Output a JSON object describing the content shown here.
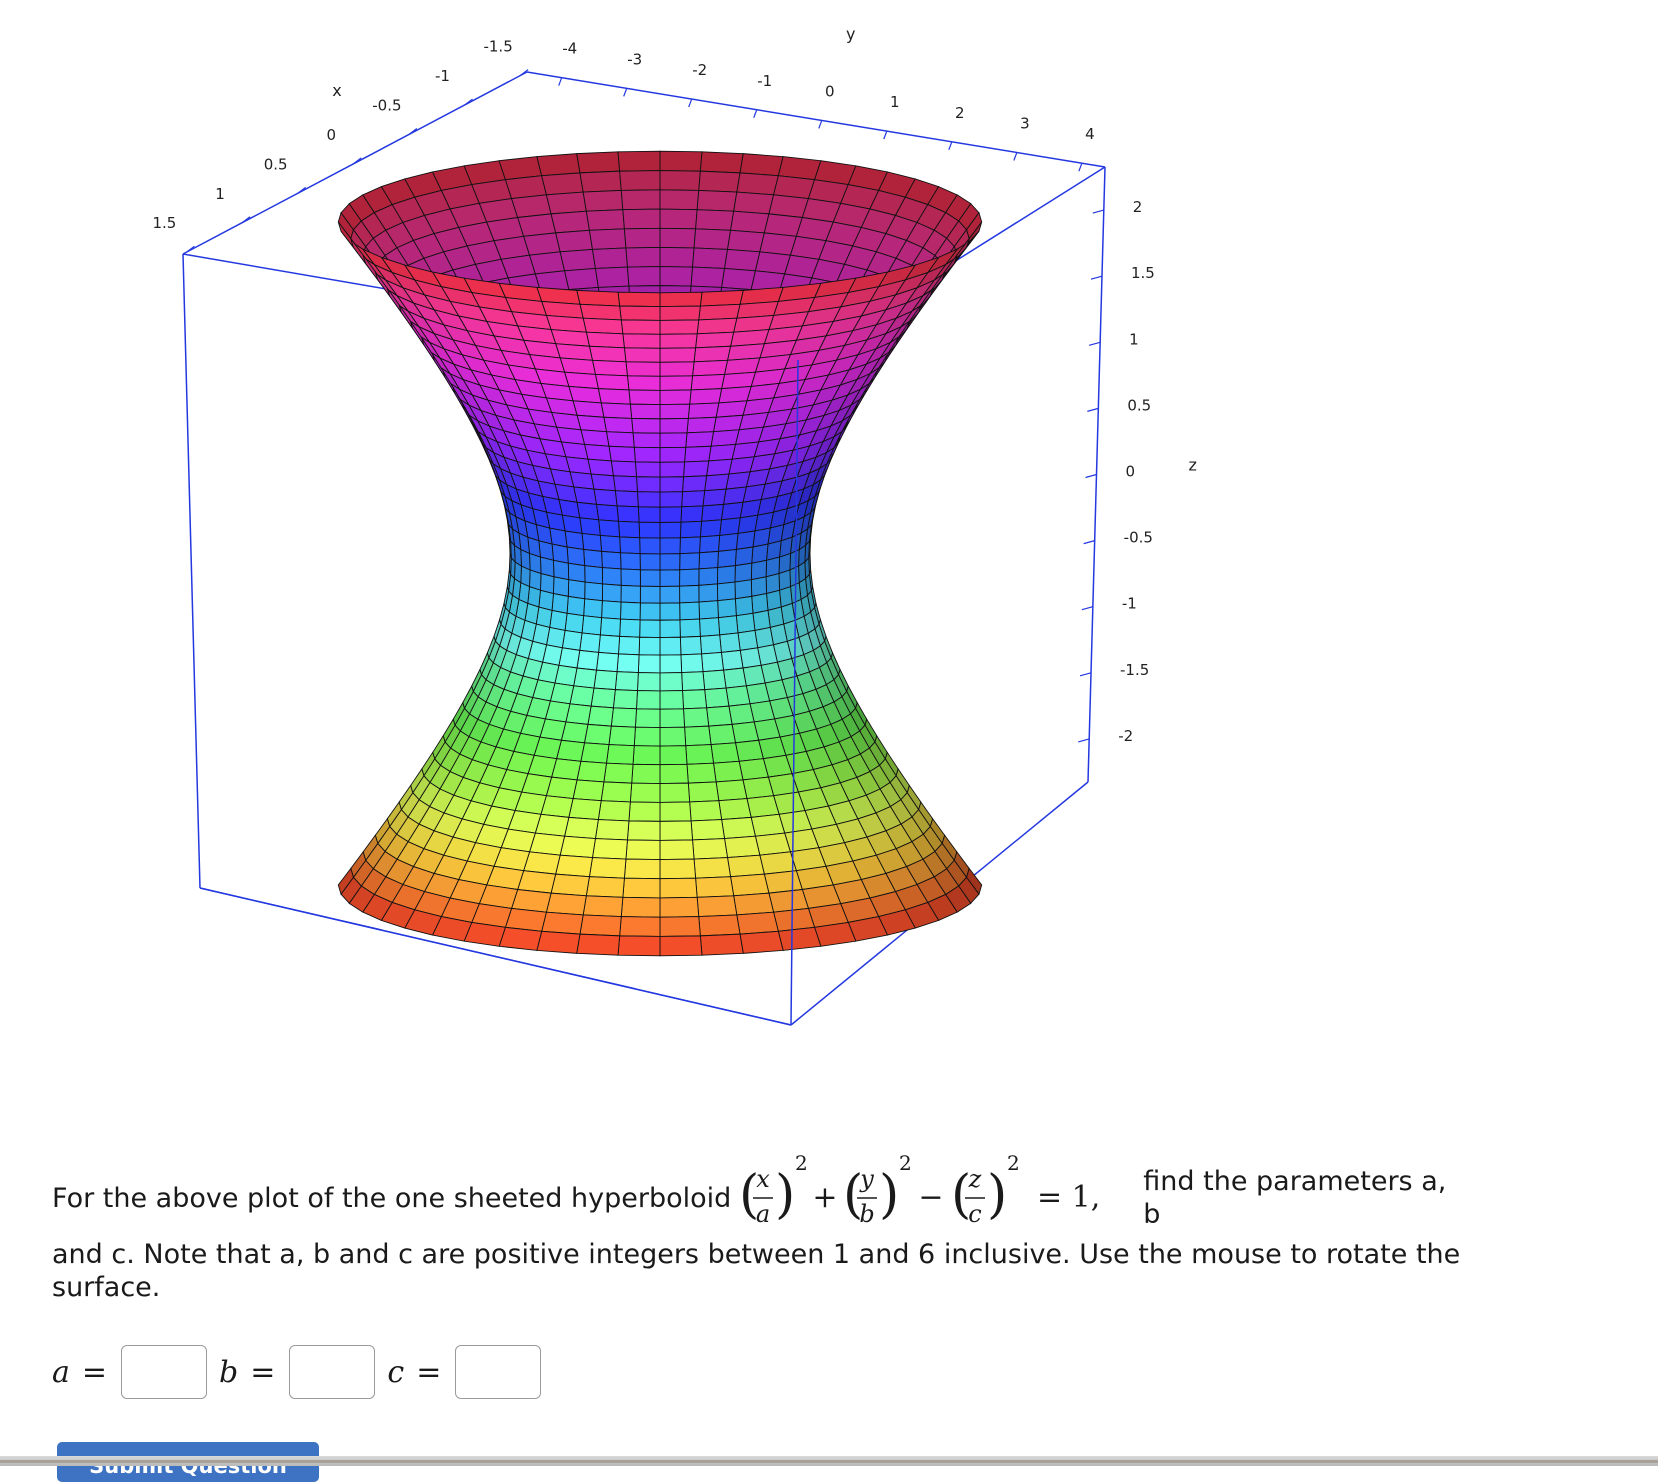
{
  "plot": {
    "surface": "one sheeted hyperboloid",
    "axis_color": "#2438e0",
    "axes": {
      "x": {
        "name": "x",
        "ticks": [
          "-1.5",
          "-1",
          "-0.5",
          "0",
          "0.5",
          "1",
          "1.5"
        ]
      },
      "y": {
        "name": "y",
        "ticks": [
          "-4",
          "-3",
          "-2",
          "-1",
          "0",
          "1",
          "2",
          "3",
          "4"
        ]
      },
      "z": {
        "name": "z",
        "ticks": [
          "2",
          "1.5",
          "1",
          "0.5",
          "0",
          "-0.5",
          "-1",
          "-1.5",
          "-2"
        ]
      }
    }
  },
  "question": {
    "prefix": "For the above plot of the one sheeted hyperboloid",
    "formula": {
      "x": "x",
      "a": "a",
      "y": "y",
      "b": "b",
      "z": "z",
      "c": "c",
      "exp": "2",
      "plus": "+",
      "minus": "−",
      "rhs": "= 1,"
    },
    "line1_suffix": "find the parameters a, b",
    "rest": "and c. Note that a, b and c are positive integers between 1 and 6 inclusive. Use the mouse to rotate the surface."
  },
  "answers": {
    "a_label": "a",
    "b_label": "b",
    "c_label": "c",
    "eq": "=",
    "a_value": "",
    "b_value": "",
    "c_value": ""
  },
  "submit": {
    "label": "Submit Question"
  }
}
